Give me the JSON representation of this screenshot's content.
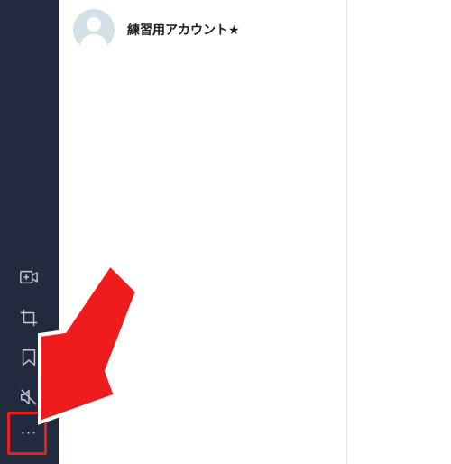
{
  "chat_list": {
    "items": [
      {
        "name": "練習用アカウント★"
      }
    ]
  },
  "sidebar": {
    "icons": [
      {
        "name": "video-plus-icon"
      },
      {
        "name": "crop-icon"
      },
      {
        "name": "bookmark-icon"
      },
      {
        "name": "mute-icon"
      },
      {
        "name": "more-icon",
        "glyph": "···"
      }
    ]
  },
  "annotation": {
    "arrow_color": "#ee1c1c",
    "highlight_color": "#ee1c1c"
  },
  "theme": {
    "sidebar_bg": "#222a3f",
    "icon_color": "#c5c9d3"
  }
}
